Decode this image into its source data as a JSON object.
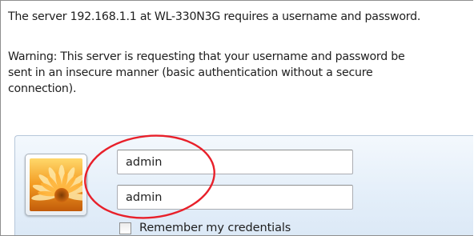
{
  "dialog": {
    "server_message": "The server 192.168.1.1 at WL-330N3G requires a username and password.",
    "warning_lines": [
      "Warning: This server is requesting that your username and password be",
      "sent in an insecure manner (basic authentication without a secure",
      "connection)."
    ]
  },
  "credentials": {
    "username_value": "admin",
    "password_value": "admin",
    "remember_label": "Remember my credentials",
    "remember_checked": false,
    "user_tile_icon": "flower-user-tile-icon"
  },
  "annotation": {
    "highlight_color": "#e8202a",
    "shape": "ellipse-around-fields"
  }
}
